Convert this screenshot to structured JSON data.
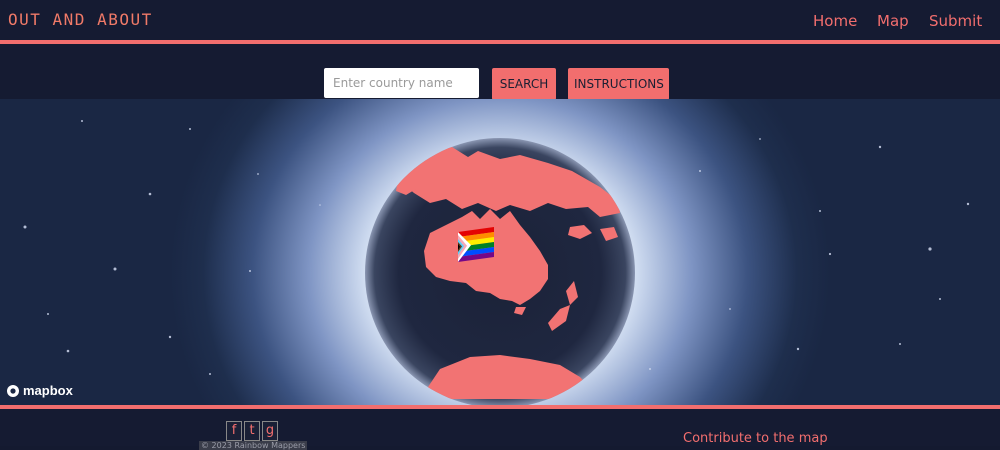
{
  "brand": "OUT AND ABOUT",
  "nav": {
    "home": "Home",
    "map": "Map",
    "submit": "Submit"
  },
  "search": {
    "placeholder": "Enter country name",
    "search_label": "SEARCH",
    "instructions_label": "INSTRUCTIONS"
  },
  "map": {
    "attribution": "mapbox"
  },
  "footer": {
    "social": {
      "facebook": "f",
      "twitter": "t",
      "github": "g"
    },
    "copyright": "© 2023 Rainbow Mappers",
    "contribute": "Contribute to the map"
  },
  "colors": {
    "accent": "#f26e6e",
    "background": "#151b32",
    "land": "#f27373"
  }
}
